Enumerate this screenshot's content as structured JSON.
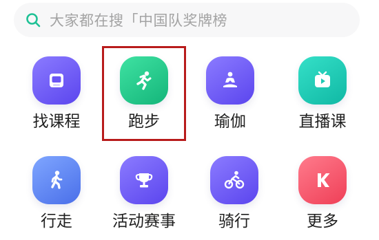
{
  "search": {
    "placeholder": "大家都在搜「中国队奖牌榜"
  },
  "highlight_color": "#b81b1b",
  "items": [
    {
      "label": "找课程",
      "icon": "course-book-icon",
      "color": "#6a55f5"
    },
    {
      "label": "跑步",
      "icon": "running-person-icon",
      "color": "#22c58a",
      "selected": true
    },
    {
      "label": "瑜伽",
      "icon": "yoga-meditation-icon",
      "color": "#6a55f5"
    },
    {
      "label": "直播课",
      "icon": "tv-live-icon",
      "color": "#1fc9b3"
    },
    {
      "label": "行走",
      "icon": "walking-person-icon",
      "color": "#5b82f0"
    },
    {
      "label": "活动赛事",
      "icon": "trophy-icon",
      "color": "#6a55f5"
    },
    {
      "label": "骑行",
      "icon": "cyclist-icon",
      "color": "#6a55f5"
    },
    {
      "label": "更多",
      "icon": "k-logo-icon",
      "color": "#f2566a"
    }
  ]
}
